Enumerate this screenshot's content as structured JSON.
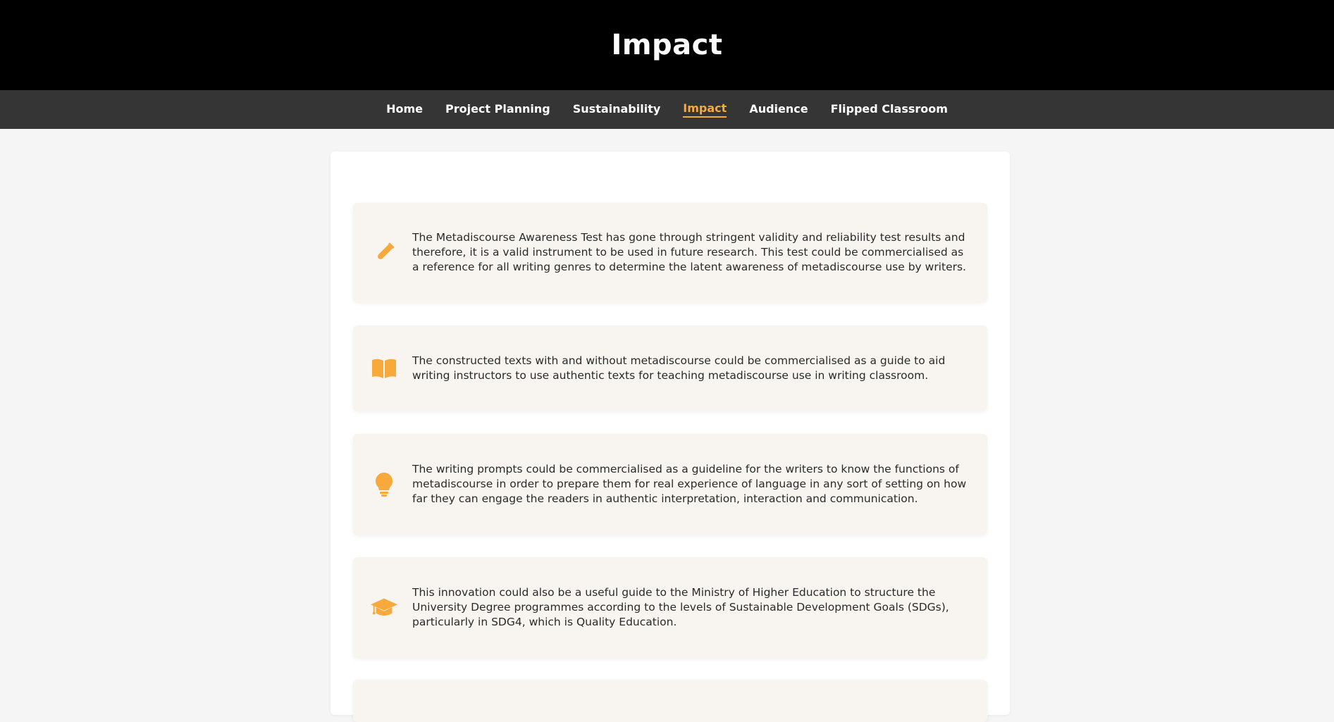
{
  "header": {
    "title": "Impact"
  },
  "nav": {
    "items": [
      {
        "label": "Home"
      },
      {
        "label": "Project Planning"
      },
      {
        "label": "Sustainability"
      },
      {
        "label": "Impact"
      },
      {
        "label": "Audience"
      },
      {
        "label": "Flipped Classroom"
      }
    ],
    "active": "Impact"
  },
  "colors": {
    "accent": "#f7a93c",
    "header_bg": "#000000",
    "nav_bg": "#353535",
    "card_bg": "#f8f5f1"
  },
  "cards": [
    {
      "icon": "test-tube-icon",
      "text": "The Metadiscourse Awareness Test has gone through stringent validity and reliability test results and therefore, it is a valid instrument to be used in future research. This test could be commercialised as a reference for all writing genres to determine the latent awareness of metadiscourse use by writers."
    },
    {
      "icon": "book-icon",
      "text": "The constructed texts with and without metadiscourse could be commercialised as a guide to aid writing instructors to use authentic texts for teaching metadiscourse use in writing classroom."
    },
    {
      "icon": "lightbulb-icon",
      "text": "The writing prompts could be commercialised as a guideline for the writers to know the functions of metadiscourse in order to prepare them for real experience of language in any sort of setting on how far they can engage the readers in authentic interpretation, interaction and communication."
    },
    {
      "icon": "graduation-cap-icon",
      "text": "This innovation could also be a useful guide to the Ministry of Higher Education to structure the University Degree programmes according to the levels of Sustainable Development Goals (SDGs), particularly in SDG4, which is Quality Education."
    }
  ]
}
